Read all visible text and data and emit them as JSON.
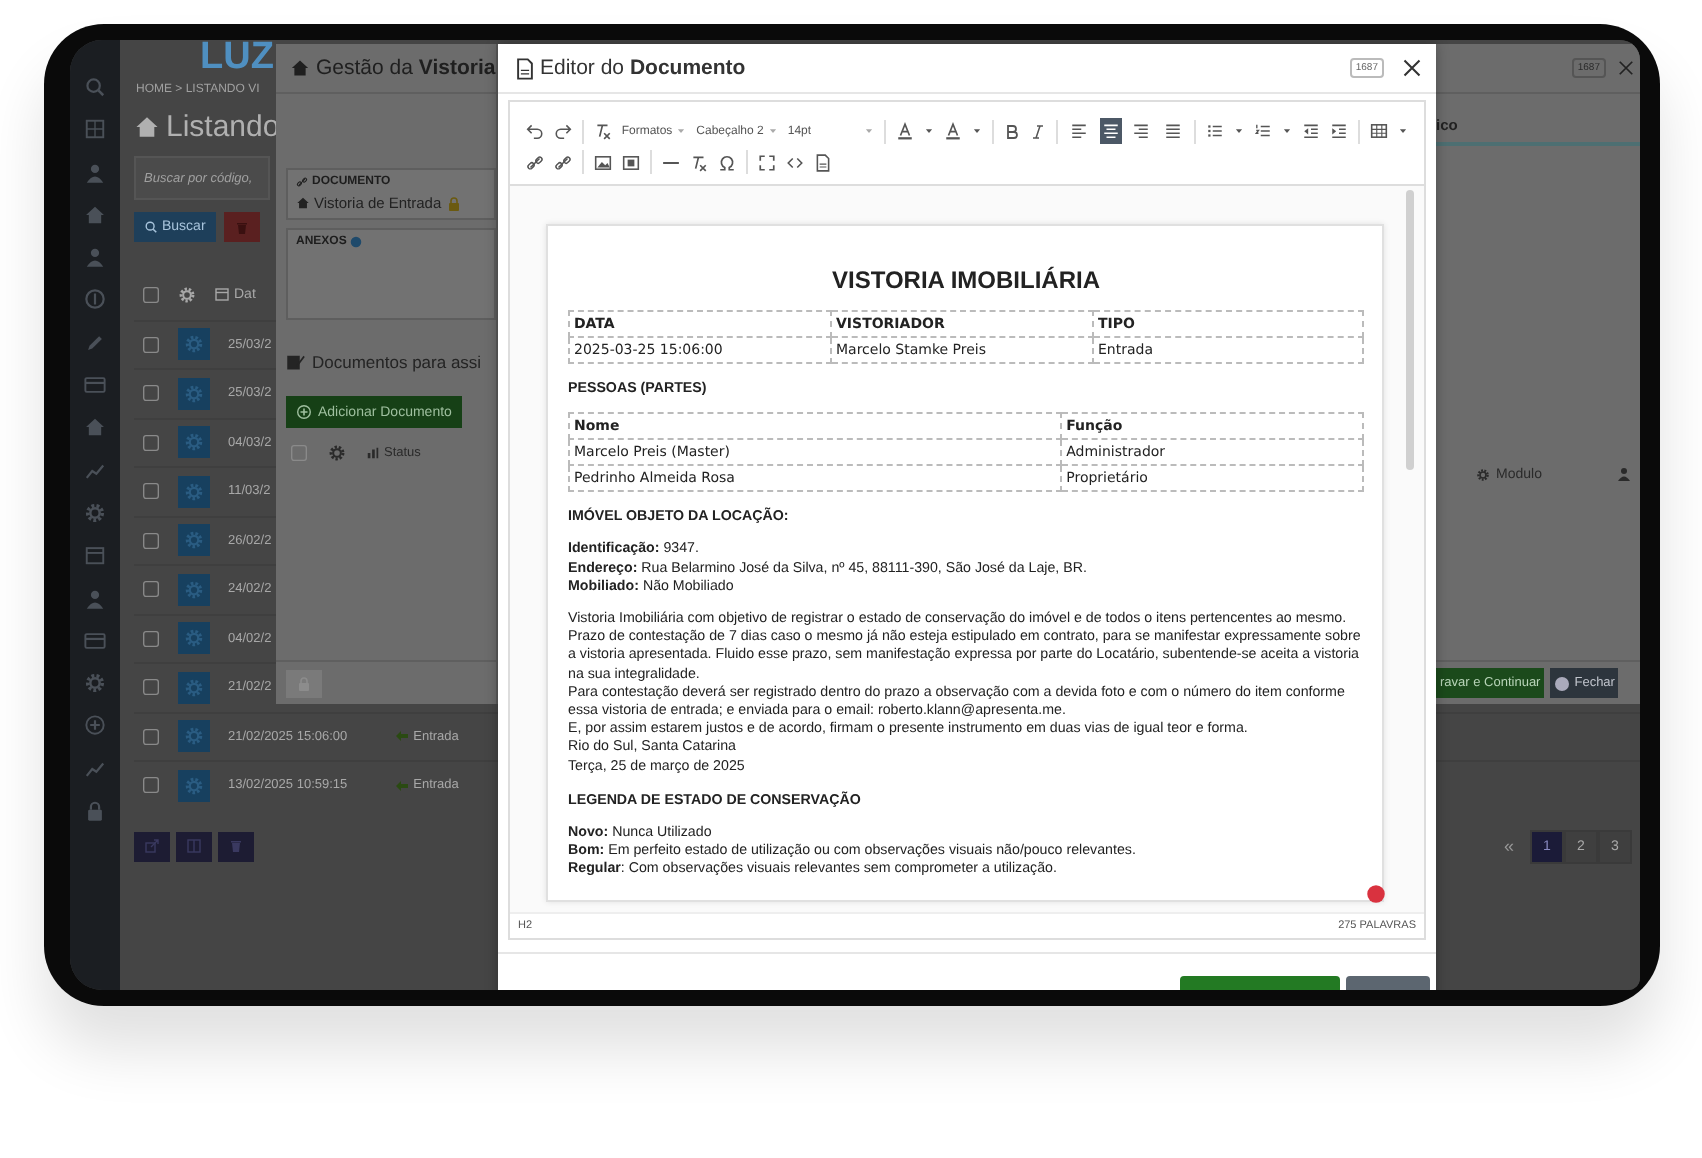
{
  "background_page": {
    "logo": "LUZ",
    "breadcrumb": "HOME > LISTANDO VI",
    "title": "Listando",
    "search": {
      "placeholder": "Buscar por código,"
    },
    "search_button": "Buscar",
    "date_column": "Dat",
    "header_checked": false,
    "rows": [
      {
        "checked": false,
        "date": "25/03/2"
      },
      {
        "checked": false,
        "date": "25/03/2"
      },
      {
        "checked": false,
        "date": "04/03/2"
      },
      {
        "checked": false,
        "date": "11/03/2"
      },
      {
        "checked": false,
        "date": "26/02/2"
      },
      {
        "checked": false,
        "date": "24/02/2"
      },
      {
        "checked": false,
        "date": "04/02/2"
      },
      {
        "checked": false,
        "date": "21/02/2"
      },
      {
        "checked": false,
        "date": "21/02/2025 15:06:00",
        "type": "Entrada"
      },
      {
        "checked": false,
        "date": "13/02/2025 10:59:15",
        "type": "Entrada"
      }
    ],
    "pagination": {
      "first": "«",
      "pages": [
        {
          "label": "1",
          "selected": true
        },
        {
          "label": "2",
          "selected": false
        },
        {
          "label": "3",
          "selected": false
        }
      ]
    }
  },
  "inspection_dialog": {
    "title": "Gestão da **Vistoria**",
    "document_label": "DOCUMENTO",
    "document_name": "Vistoria de Entrada",
    "attachments_label": "ANEXOS",
    "documents_heading": "Documentos para assi",
    "add_button": "Adicionar Documento",
    "status_column": "Status",
    "header_checked": false,
    "tab_fragment": "ico",
    "module_column": "Modulo",
    "record_badge": "1687",
    "save_button": "ravar e Continuar",
    "close_button": "Fechar"
  },
  "editor_dialog": {
    "title": "Editor do **Documento**",
    "record_badge": "1687",
    "toolbar": {
      "format_menu": "Formatos",
      "block_menu": "Cabeçalho 2",
      "size_menu": "14pt",
      "align_buttons": [
        {
          "kind": "left",
          "selected": false
        },
        {
          "kind": "center",
          "selected": true
        },
        {
          "kind": "right",
          "selected": false
        },
        {
          "kind": "justify",
          "selected": false
        }
      ]
    },
    "document": {
      "title": "VISTORIA IMOBILIÁRIA",
      "summary_table": {
        "columns": [
          "DATA",
          "VISTORIADOR",
          "TIPO"
        ],
        "rows": [
          [
            "2025-03-25 15:06:00",
            "Marcelo Stamke Preis",
            "Entrada"
          ]
        ]
      },
      "parties_heading": "PESSOAS (PARTES)",
      "parties_table": {
        "columns": [
          "Nome",
          "Função"
        ],
        "rows": [
          [
            "Marcelo Preis (Master)",
            "Administrador"
          ],
          [
            "Pedrinho Almeida Rosa",
            "Proprietário"
          ]
        ]
      },
      "property_heading": "IMÓVEL OBJETO DA LOCAÇÃO:",
      "property_lines": [
        "**Identificação:** 9347.",
        "**Endereço:** Rua Belarmino José da Silva, nº 45, 88111-390, São José da Laje, BR.",
        "**Mobiliado:** Não Mobiliado"
      ],
      "paragraphs": [
        "Vistoria Imobiliária com objetivo de registrar o estado de conservação do imóvel e de todos o itens pertencentes ao mesmo. Prazo de contestação de 7 dias caso o mesmo já não esteja estipulado em contrato, para se manifestar expressamente sobre a vistoria apresentada. Fluido esse prazo, sem manifestação expressa por parte do Locatário, subentende-se aceita a vistoria na sua integralidade.",
        "Para contestação deverá ser registrado dentro do prazo a observação com a devida foto e com o número do item conforme essa vistoria de entrada; e enviada para o email: roberto.klann@apresenta.me.",
        "E, por assim estarem justos e de acordo, firmam o presente instrumento em duas vias de igual teor e forma.",
        "Rio do Sul, Santa Catarina",
        "Terça, 25 de março de 2025"
      ],
      "legend_heading": "LEGENDA DE ESTADO DE CONSERVAÇÃO",
      "legend_lines": [
        "**Novo:** Nunca Utilizado",
        "**Bom:** Em perfeito estado de utilização ou com observações visuais não/pouco relevantes.",
        "**Regular**: Com observações visuais relevantes sem comprometer a utilização."
      ]
    },
    "status_bar": {
      "element_path": "H2",
      "word_count": "275 PALAVRAS"
    }
  }
}
